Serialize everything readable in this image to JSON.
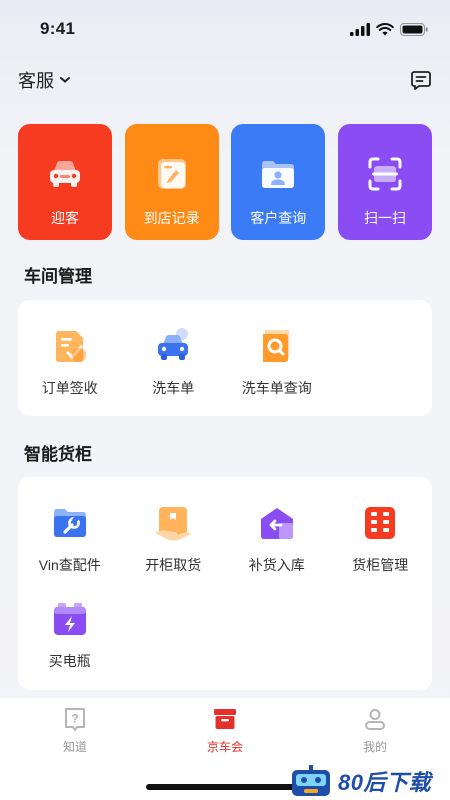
{
  "status_bar": {
    "time": "9:41"
  },
  "header": {
    "title": "客服"
  },
  "quick_actions": [
    {
      "label": "迎客",
      "color": "#f63b20",
      "icon": "car-icon"
    },
    {
      "label": "到店记录",
      "color": "#ff8b16",
      "icon": "note-icon"
    },
    {
      "label": "客户查询",
      "color": "#3b7cf6",
      "icon": "folder-user-icon"
    },
    {
      "label": "扫一扫",
      "color": "#8a4cf3",
      "icon": "scan-icon"
    }
  ],
  "workshop": {
    "title": "车间管理",
    "items": [
      {
        "label": "订单签收",
        "icon": "order-check-icon"
      },
      {
        "label": "洗车单",
        "icon": "car-wash-icon"
      },
      {
        "label": "洗车单查询",
        "icon": "search-doc-icon"
      }
    ]
  },
  "cabinet": {
    "title": "智能货柜",
    "items": [
      {
        "label": "Vin查配件",
        "icon": "wrench-folder-icon"
      },
      {
        "label": "开柜取货",
        "icon": "box-open-icon"
      },
      {
        "label": "补货入库",
        "icon": "warehouse-in-icon"
      },
      {
        "label": "货柜管理",
        "icon": "cabinet-grid-icon"
      },
      {
        "label": "买电瓶",
        "icon": "battery-icon"
      }
    ]
  },
  "tabbar": {
    "tabs": [
      {
        "label": "知道",
        "icon": "question-icon",
        "active": false
      },
      {
        "label": "京车会",
        "icon": "store-icon",
        "active": true
      },
      {
        "label": "我的",
        "icon": "user-icon",
        "active": false
      }
    ]
  },
  "watermark": {
    "text": "80后下载"
  }
}
